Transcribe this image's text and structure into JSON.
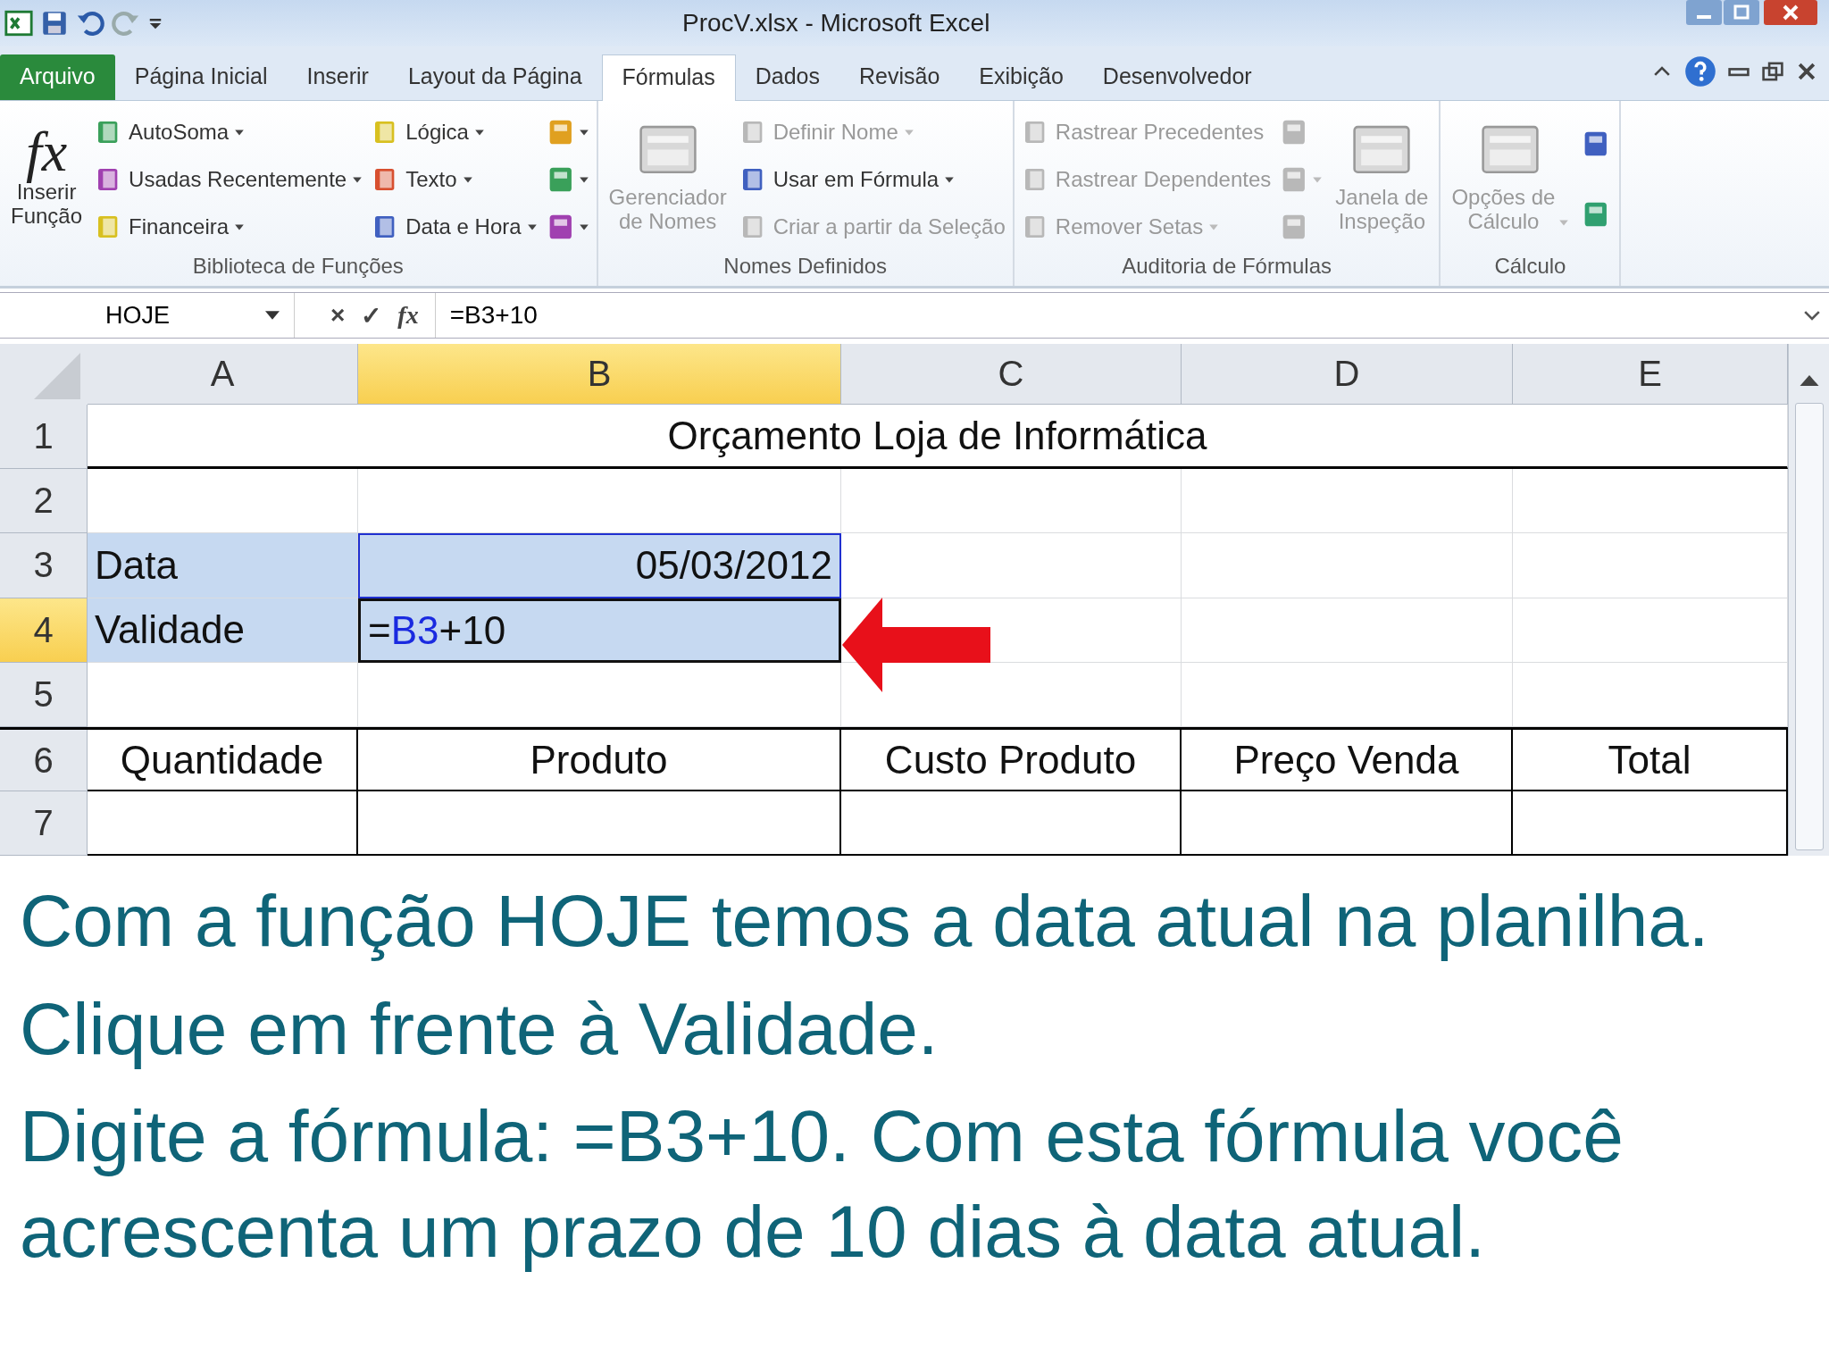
{
  "window": {
    "title": "ProcV.xlsx - Microsoft Excel"
  },
  "ribbon_tabs": [
    {
      "label": "Arquivo",
      "kind": "file",
      "selected": false
    },
    {
      "label": "Página Inicial",
      "kind": "tab",
      "selected": false
    },
    {
      "label": "Inserir",
      "kind": "tab",
      "selected": false
    },
    {
      "label": "Layout da Página",
      "kind": "tab",
      "selected": false
    },
    {
      "label": "Fórmulas",
      "kind": "tab",
      "selected": true
    },
    {
      "label": "Dados",
      "kind": "tab",
      "selected": false
    },
    {
      "label": "Revisão",
      "kind": "tab",
      "selected": false
    },
    {
      "label": "Exibição",
      "kind": "tab",
      "selected": false
    },
    {
      "label": "Desenvolvedor",
      "kind": "tab",
      "selected": false
    }
  ],
  "ribbon_groups": [
    {
      "label": "Biblioteca de Funções",
      "columns": [
        {
          "kind": "large",
          "items": [
            {
              "label": "Inserir\nFunção",
              "glyph": "fx",
              "dropdown": false,
              "disabled": false
            }
          ]
        },
        {
          "kind": "stack",
          "items": [
            {
              "label": "AutoSoma",
              "dropdown": true,
              "disabled": false
            },
            {
              "label": "Usadas Recentemente",
              "dropdown": true,
              "disabled": false
            },
            {
              "label": "Financeira",
              "dropdown": true,
              "disabled": false
            }
          ]
        },
        {
          "kind": "stack",
          "items": [
            {
              "label": "Lógica",
              "dropdown": true,
              "disabled": false
            },
            {
              "label": "Texto",
              "dropdown": true,
              "disabled": false
            },
            {
              "label": "Data e Hora",
              "dropdown": true,
              "disabled": false
            }
          ]
        },
        {
          "kind": "icons",
          "items": [
            {
              "dropdown": true,
              "disabled": false
            },
            {
              "dropdown": true,
              "disabled": false
            },
            {
              "dropdown": true,
              "disabled": false
            }
          ]
        }
      ]
    },
    {
      "label": "Nomes Definidos",
      "columns": [
        {
          "kind": "large",
          "items": [
            {
              "label": "Gerenciador\nde Nomes",
              "dropdown": false,
              "disabled": true
            }
          ]
        },
        {
          "kind": "stack",
          "items": [
            {
              "label": "Definir Nome",
              "dropdown": true,
              "disabled": true
            },
            {
              "label": "Usar em Fórmula",
              "dropdown": true,
              "disabled": false
            },
            {
              "label": "Criar a partir da Seleção",
              "dropdown": false,
              "disabled": true
            }
          ]
        }
      ]
    },
    {
      "label": "Auditoria de Fórmulas",
      "columns": [
        {
          "kind": "stack",
          "items": [
            {
              "label": "Rastrear Precedentes",
              "dropdown": false,
              "disabled": true
            },
            {
              "label": "Rastrear Dependentes",
              "dropdown": false,
              "disabled": true
            },
            {
              "label": "Remover Setas",
              "dropdown": true,
              "disabled": true
            }
          ]
        },
        {
          "kind": "icons",
          "items": [
            {
              "dropdown": false,
              "disabled": true
            },
            {
              "dropdown": true,
              "disabled": true
            },
            {
              "dropdown": false,
              "disabled": true
            }
          ]
        },
        {
          "kind": "large",
          "items": [
            {
              "label": "Janela de\nInspeção",
              "dropdown": false,
              "disabled": true
            }
          ]
        }
      ]
    },
    {
      "label": "Cálculo",
      "columns": [
        {
          "kind": "large",
          "items": [
            {
              "label": "Opções de\nCálculo",
              "dropdown": true,
              "disabled": true
            }
          ]
        },
        {
          "kind": "icons",
          "items": [
            {
              "dropdown": false,
              "disabled": false
            },
            {
              "dropdown": false,
              "disabled": false
            }
          ]
        }
      ]
    }
  ],
  "formula_bar": {
    "name_box": "HOJE",
    "buttons": [
      "×",
      "✓",
      "fx"
    ],
    "formula": "=B3+10"
  },
  "columns": [
    {
      "label": "A",
      "selected": false
    },
    {
      "label": "B",
      "selected": true
    },
    {
      "label": "C",
      "selected": false
    },
    {
      "label": "D",
      "selected": false
    },
    {
      "label": "E",
      "selected": false
    }
  ],
  "rows": [
    {
      "label": "1",
      "selected": false,
      "kind": "title",
      "cells": [
        {
          "text": "Orçamento Loja de Informática"
        }
      ]
    },
    {
      "label": "2",
      "selected": false,
      "kind": "plain",
      "cells": []
    },
    {
      "label": "3",
      "selected": false,
      "kind": "plain",
      "cells": [
        {
          "text": "Data",
          "kind": "text",
          "highlighted": true
        },
        {
          "text": "05/03/2012",
          "kind": "number",
          "highlighted": true,
          "referenced": true
        }
      ]
    },
    {
      "label": "4",
      "selected": true,
      "kind": "plain",
      "cells": [
        {
          "text": "Validade",
          "kind": "text",
          "highlighted": true
        },
        {
          "kind": "formula",
          "parts": [
            {
              "text": "=",
              "kind": "plain"
            },
            {
              "text": "B3",
              "kind": "ref"
            },
            {
              "text": "+10",
              "kind": "plain"
            }
          ],
          "highlighted": true,
          "active": true
        }
      ]
    },
    {
      "label": "5",
      "selected": false,
      "kind": "plain",
      "cells": []
    },
    {
      "label": "6",
      "selected": false,
      "kind": "table-header",
      "cells": [
        {
          "text": "Quantidade",
          "kind": "text",
          "highlighted": false
        },
        {
          "text": "Produto",
          "kind": "text",
          "highlighted": false
        },
        {
          "text": "Custo Produto",
          "kind": "text",
          "highlighted": false
        },
        {
          "text": "Preço Venda",
          "kind": "text",
          "highlighted": false
        },
        {
          "text": "Total",
          "kind": "text",
          "highlighted": false
        }
      ]
    },
    {
      "label": "7",
      "selected": false,
      "kind": "table-body",
      "cells": []
    }
  ],
  "caption": [
    "Com a função HOJE temos a data atual na planilha.",
    "Clique em frente à Validade.",
    "Digite a fórmula: =B3+10. Com esta fórmula você acrescenta um prazo de 10 dias à data atual."
  ]
}
